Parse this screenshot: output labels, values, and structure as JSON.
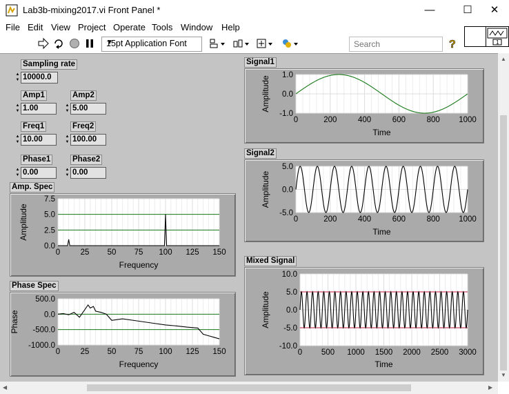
{
  "window": {
    "title": "Lab3b-mixing2017.vi Front Panel *"
  },
  "menu": [
    "File",
    "Edit",
    "View",
    "Project",
    "Operate",
    "Tools",
    "Window",
    "Help"
  ],
  "toolbar": {
    "font": "15pt Application Font",
    "search_placeholder": "Search"
  },
  "controls": {
    "sampling_rate": {
      "label": "Sampling rate",
      "value": "10000.0"
    },
    "amp1": {
      "label": "Amp1",
      "value": "1.00"
    },
    "amp2": {
      "label": "Amp2",
      "value": "5.00"
    },
    "freq1": {
      "label": "Freq1",
      "value": "10.00"
    },
    "freq2": {
      "label": "Freq2",
      "value": "100.00"
    },
    "phase1": {
      "label": "Phase1",
      "value": "0.00"
    },
    "phase2": {
      "label": "Phase2",
      "value": "0.00"
    }
  },
  "graphs": {
    "amp_spec": {
      "label": "Amp. Spec",
      "xlabel": "Frequency",
      "ylabel": "Amplitude",
      "xticks": [
        "0",
        "25",
        "50",
        "75",
        "100",
        "125",
        "150"
      ],
      "yticks": [
        "7.5",
        "5.0",
        "2.5",
        "0.0"
      ]
    },
    "phase_spec": {
      "label": "Phase Spec",
      "xlabel": "Frequency",
      "ylabel": "Phase",
      "xticks": [
        "0",
        "25",
        "50",
        "75",
        "100",
        "125",
        "150"
      ],
      "yticks": [
        "500.0",
        "0.0",
        "-500.0",
        "-1000.0"
      ]
    },
    "signal1": {
      "label": "Signal1",
      "xlabel": "Time",
      "ylabel": "Amplitude",
      "xticks": [
        "0",
        "200",
        "400",
        "600",
        "800",
        "1000"
      ],
      "yticks": [
        "1.0",
        "0.0",
        "-1.0"
      ]
    },
    "signal2": {
      "label": "Signal2",
      "xlabel": "Time",
      "ylabel": "Amplitude",
      "xticks": [
        "0",
        "200",
        "400",
        "600",
        "800",
        "1000"
      ],
      "yticks": [
        "5.0",
        "0.0",
        "-5.0"
      ]
    },
    "mixed": {
      "label": "Mixed Signal",
      "xlabel": "Time",
      "ylabel": "Amplitude",
      "xticks": [
        "0",
        "500",
        "1000",
        "1500",
        "2000",
        "2500",
        "3000"
      ],
      "yticks": [
        "10.0",
        "5.0",
        "0.0",
        "-5.0",
        "-10.0"
      ]
    }
  },
  "chart_data": [
    {
      "name": "amp_spec",
      "type": "line",
      "xlim": [
        0,
        150
      ],
      "ylim": [
        0,
        7.5
      ],
      "grid": true,
      "series": [
        {
          "values_x": [
            0,
            9,
            10,
            11,
            99,
            100,
            101,
            150
          ],
          "values_y": [
            0,
            0,
            1.0,
            0,
            0,
            5.0,
            0,
            0
          ],
          "color": "#000000"
        }
      ],
      "gridlines_y": [
        2.5,
        5.0
      ],
      "gridline_color": "#1a7a1a"
    },
    {
      "name": "phase_spec",
      "type": "line",
      "xlim": [
        0,
        150
      ],
      "ylim": [
        -1000,
        500
      ],
      "grid": true,
      "series": [
        {
          "values_x": [
            0,
            5,
            10,
            15,
            20,
            25,
            28,
            30,
            33,
            35,
            40,
            45,
            50,
            60,
            70,
            80,
            90,
            100,
            110,
            120,
            130,
            135,
            140,
            145,
            150
          ],
          "values_y": [
            0,
            20,
            -20,
            60,
            -100,
            150,
            300,
            200,
            250,
            100,
            60,
            0,
            -200,
            -150,
            -200,
            -250,
            -300,
            -350,
            -380,
            -420,
            -450,
            -650,
            -700,
            -750,
            -800
          ],
          "color": "#000000"
        }
      ],
      "gridlines_y": [
        0,
        -500
      ],
      "gridline_color": "#1a7a1a"
    },
    {
      "name": "signal1",
      "type": "line",
      "xlim": [
        0,
        1000
      ],
      "ylim": [
        -1,
        1
      ],
      "grid": true,
      "series": [
        {
          "function": "sine",
          "amplitude": 1,
          "cycles": 1,
          "color": "#1a7a1a"
        }
      ]
    },
    {
      "name": "signal2",
      "type": "line",
      "xlim": [
        0,
        1000
      ],
      "ylim": [
        -5,
        5
      ],
      "grid": true,
      "series": [
        {
          "function": "sine",
          "amplitude": 5,
          "cycles": 10,
          "color": "#000000"
        }
      ]
    },
    {
      "name": "mixed",
      "type": "line",
      "xlim": [
        0,
        3000
      ],
      "ylim": [
        -10,
        10
      ],
      "grid": true,
      "series": [
        {
          "function": "sine",
          "amplitude": 5,
          "cycles": 30,
          "color": "#000000"
        }
      ],
      "envelope": {
        "values_y": [
          5,
          -5
        ],
        "color": "#c0143c"
      }
    }
  ]
}
